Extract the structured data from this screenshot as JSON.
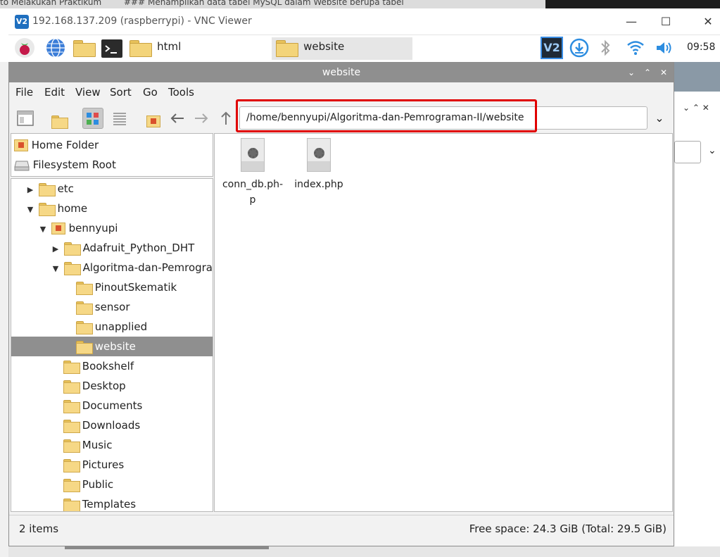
{
  "host": {
    "tab1": "to Melakukan  Praktikum",
    "tab2": "### Menampilkan data tabel MySQL dalam Website berupa tabel"
  },
  "vnc": {
    "logo": "V2",
    "title": "192.168.137.209 (raspberrypi) - VNC Viewer",
    "minimize": "—",
    "maximize": "☐",
    "close": "✕"
  },
  "panel": {
    "task_html": "html",
    "task_website": "website",
    "tray_vnc": "V2",
    "clock": "09:58"
  },
  "fm": {
    "title": "website",
    "menus": [
      "File",
      "Edit",
      "View",
      "Sort",
      "Go",
      "Tools"
    ],
    "address": "/home/bennyupi/Algoritma-dan-Pemrograman-II/website",
    "places": [
      "Home Folder",
      "Filesystem Root"
    ],
    "tree": [
      {
        "label": "etc",
        "arrow": "▶"
      },
      {
        "label": "home",
        "arrow": "▼"
      },
      {
        "label": "bennyupi",
        "arrow": "▼"
      },
      {
        "label": "Adafruit_Python_DHT",
        "arrow": "▶"
      },
      {
        "label": "Algoritma-dan-Pemrograman-II",
        "arrow": "▼"
      },
      {
        "label": "PinoutSkematik",
        "arrow": ""
      },
      {
        "label": "sensor",
        "arrow": ""
      },
      {
        "label": "unapplied",
        "arrow": ""
      },
      {
        "label": "website",
        "arrow": ""
      },
      {
        "label": "Bookshelf",
        "arrow": ""
      },
      {
        "label": "Desktop",
        "arrow": ""
      },
      {
        "label": "Documents",
        "arrow": ""
      },
      {
        "label": "Downloads",
        "arrow": ""
      },
      {
        "label": "Music",
        "arrow": ""
      },
      {
        "label": "Pictures",
        "arrow": ""
      },
      {
        "label": "Public",
        "arrow": ""
      },
      {
        "label": "Templates",
        "arrow": ""
      }
    ],
    "files": [
      {
        "name_line1": "conn_db.ph-",
        "name_line2": "p"
      },
      {
        "name_line1": "index.php",
        "name_line2": ""
      }
    ],
    "status_left": "2 items",
    "status_right": "Free space: 24.3 GiB (Total: 29.5 GiB)"
  },
  "colors": {
    "highlight": "#e00000",
    "titlebar": "#8f8f8f",
    "selection": "#8f8f8f",
    "folder": "#f6d886"
  }
}
